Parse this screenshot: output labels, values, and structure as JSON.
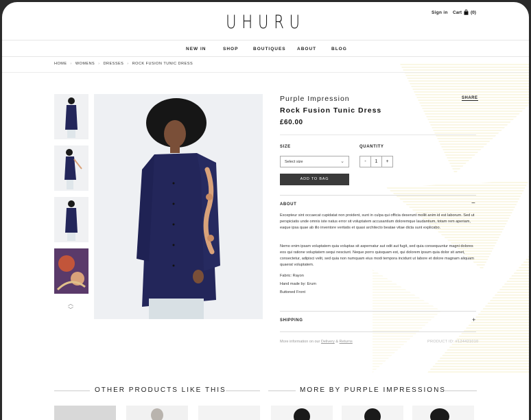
{
  "header": {
    "logo": "UHURU",
    "signin": "Sign in",
    "cart_label": "Cart",
    "cart_count": "(0)"
  },
  "nav": [
    "NEW IN",
    "SHOP",
    "BOUTIQUES",
    "ABOUT",
    "BLOG"
  ],
  "breadcrumb": [
    "HOME",
    "WOMENS",
    "DRESSES",
    "ROCK FUSION TUNIC DRESS"
  ],
  "product": {
    "brand": "Purple Impression",
    "name": "Rock Fusion Tunic Dress",
    "price": "£60.00",
    "share": "SHARE",
    "size_label": "SIZE",
    "size_value": "Select size",
    "quantity_label": "QUANTITY",
    "qty_minus": "-",
    "qty_value": "1",
    "qty_plus": "+",
    "add_to_bag": "ADD TO BAG"
  },
  "about": {
    "heading": "ABOUT",
    "toggle": "−",
    "p1": "Excepteur sint occaecat cupidatat non proident, sunt in culpa qui officia deserunt mollit anim id est laborum. Sed ut perspiciatis unde omnis iste natus error sit voluptatem accusantium doloremque laudantium, totam rem aperiam, eaque ipsa quae ab illo inventore veritatis et quasi architecto beatae vitae dicta sunt explicabo.",
    "p2": "Nemo enim ipsam voluptatem quia voluptas sit aspernatur aut odit aut fugit, sed quia consequuntur magni dolores eos qui ratione voluptatem sequi nesciunt. Neque porro quisquam est, qui dolorem ipsum quia dolor sit amet, consectetur, adipisci velit, sed quia non numquam eius modi tempora incidunt ut labore et dolore magnam aliquam quaerat voluptatem.",
    "fabric": "Fabric: Rayon",
    "handmade": "Hand made by: Erum",
    "front": "Buttoned Front"
  },
  "shipping": {
    "heading": "SHIPPING",
    "toggle": "+"
  },
  "footer_info": {
    "prefix": "More information on our",
    "delivery": "Delivery",
    "amp": "&",
    "returns": "Returns",
    "product_id": "PRODUCT ID: #124421010"
  },
  "sections": {
    "other": "OTHER PRODUCTS LIKE THIS",
    "more": "MORE BY PURPLE IMPRESSIONS"
  },
  "colors": {
    "dress": "#23265a",
    "embroidery": "#d9a27a",
    "button_dark": "#3a3a3a",
    "deco_yellow": "#f6efc8"
  }
}
